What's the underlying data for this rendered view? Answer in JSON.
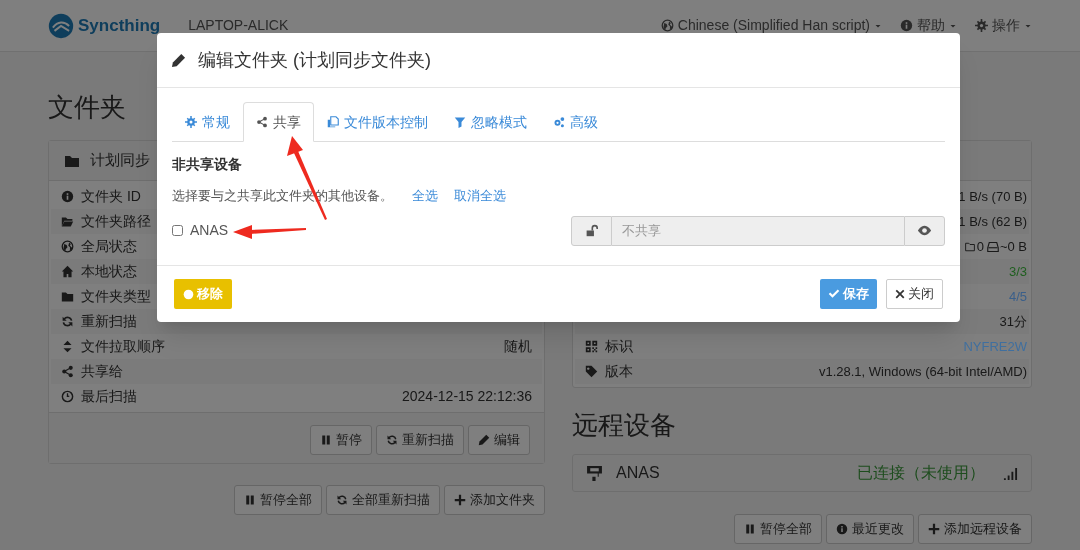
{
  "navbar": {
    "brand": "Syncthing",
    "device_name": "LAPTOP-ALICK",
    "menus": [
      {
        "label": "Chinese (Simplified Han script)"
      },
      {
        "label": "帮助"
      },
      {
        "label": "操作"
      }
    ]
  },
  "folders": {
    "heading": "文件夹",
    "panel": {
      "title": "计划同步",
      "rows": [
        {
          "label": "文件夹 ID"
        },
        {
          "label": "文件夹路径"
        },
        {
          "label": "全局状态"
        },
        {
          "label": "本地状态"
        },
        {
          "label": "文件夹类型"
        },
        {
          "label": "重新扫描"
        },
        {
          "label": "文件拉取顺序",
          "value": "随机"
        },
        {
          "label": "共享给"
        },
        {
          "label": "最后扫描",
          "value": "2024-12-15 22:12:36"
        }
      ],
      "buttons": [
        "暂停",
        "重新扫描",
        "编辑"
      ]
    },
    "buttons": [
      "暂停全部",
      "全部重新扫描",
      "添加文件夹"
    ]
  },
  "this_device": {
    "rows": [
      {
        "value": "1 B/s (70 B)"
      },
      {
        "value": "1 B/s (62 B)"
      },
      {
        "kind": "counts",
        "parts": [
          "0",
          "~0 B"
        ]
      },
      {
        "value": "3/3",
        "color": "#1f5f1f"
      },
      {
        "value": "4/5",
        "color": "#3a5f8a"
      },
      {
        "value": "31分"
      },
      {
        "label": "标识",
        "value": "NYFRE2W",
        "color": "#3f6f9f"
      },
      {
        "label": "版本",
        "value": "v1.28.1, Windows (64-bit Intel/AMD)"
      }
    ]
  },
  "remote_devices": {
    "heading": "远程设备",
    "devices": [
      {
        "name": "ANAS",
        "status": "已连接（未使用）"
      }
    ],
    "buttons": [
      "暂停全部",
      "最近更改",
      "添加远程设备"
    ]
  },
  "dialog": {
    "title": "编辑文件夹 (计划同步文件夹)",
    "tabs": [
      {
        "label": "常规",
        "selected": false
      },
      {
        "label": "共享",
        "selected": true
      },
      {
        "label": "文件版本控制",
        "selected": false
      },
      {
        "label": "忽略模式",
        "selected": false
      },
      {
        "label": "高级",
        "selected": false
      }
    ],
    "heading": "非共享设备",
    "description": "选择要与之共享此文件夹的其他设备。",
    "links": [
      "全选",
      "取消全选"
    ],
    "devices": [
      {
        "name": "ANAS",
        "checked": false,
        "encrypted": false,
        "password_visible": false,
        "password_placeholder": "不共享"
      }
    ],
    "remove_button": "移除",
    "save_button": "保存",
    "close_button": "关闭"
  }
}
